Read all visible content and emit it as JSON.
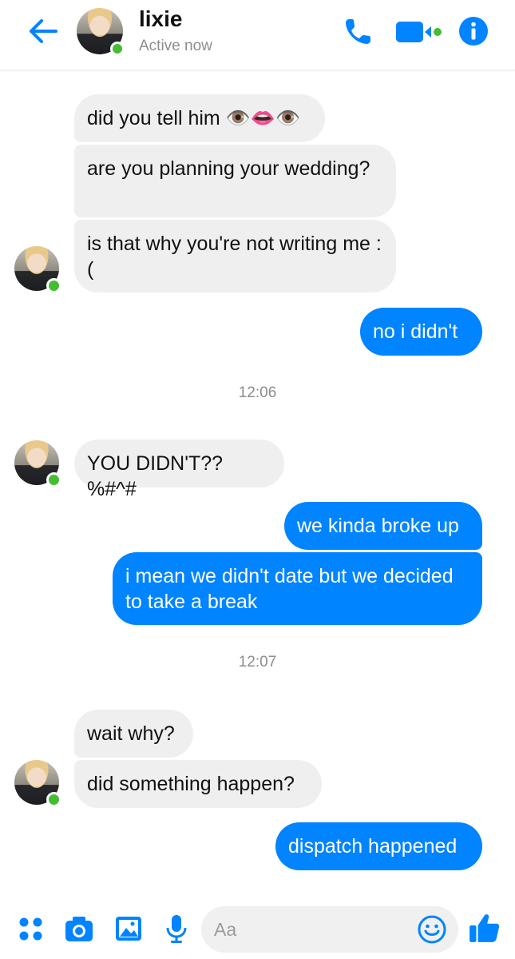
{
  "header": {
    "name": "lixie",
    "status": "Active now",
    "accent": "#0084ff",
    "presence_color": "#44bd32",
    "icons": [
      "back-arrow-icon",
      "phone-icon",
      "video-camera-icon",
      "info-icon"
    ]
  },
  "messages": [
    {
      "dir": "in",
      "text": "did you tell him 👁️👄👁️"
    },
    {
      "dir": "in",
      "text": "are you planning your wedding?"
    },
    {
      "dir": "in",
      "text": "is that why you're not writing me :("
    },
    {
      "dir": "out",
      "text": "no i didn't"
    },
    {
      "dir": "in",
      "text": "YOU DIDN'T??%#^#"
    },
    {
      "dir": "out",
      "text": "we kinda broke up"
    },
    {
      "dir": "out",
      "text": "i mean we didn't date but we decided to take a break"
    },
    {
      "dir": "in",
      "text": "wait why?"
    },
    {
      "dir": "in",
      "text": "did something happen?"
    },
    {
      "dir": "out",
      "text": "dispatch happened"
    }
  ],
  "timestamps": [
    "12:06",
    "12:07"
  ],
  "composer": {
    "placeholder": "Aa",
    "icons": [
      "apps-grid-icon",
      "camera-icon",
      "gallery-icon",
      "microphone-icon",
      "emoji-icon",
      "thumbs-up-icon"
    ]
  }
}
